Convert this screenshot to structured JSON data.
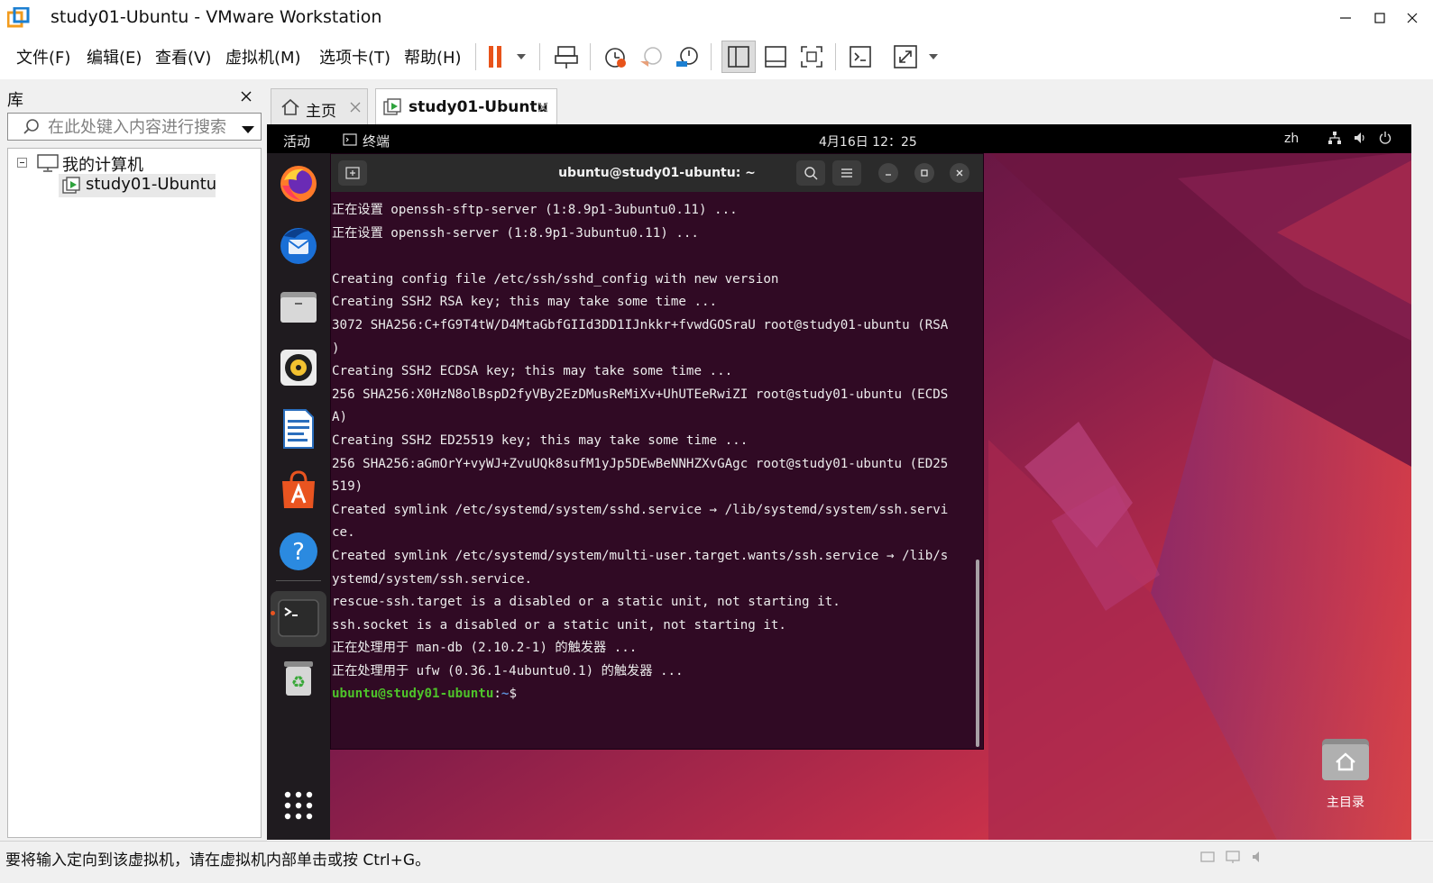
{
  "window": {
    "title": "study01-Ubuntu - VMware Workstation"
  },
  "menubar": {
    "items": [
      "文件(F)",
      "编辑(E)",
      "查看(V)",
      "虚拟机(M)",
      "选项卡(T)",
      "帮助(H)"
    ]
  },
  "library": {
    "title": "库",
    "search_placeholder": "在此处键入内容进行搜索",
    "tree_root": "我的计算机",
    "tree_vm": "study01-Ubuntu"
  },
  "tabs": [
    {
      "label": "主页"
    },
    {
      "label": "study01-Ubuntu"
    }
  ],
  "guest": {
    "activities": "活动",
    "app_menu": "终端",
    "clock": "4月16日  12：25",
    "language": "zh",
    "desktop_home_label": "主目录",
    "dock_icons": [
      "firefox",
      "thunderbird",
      "files",
      "rhythmbox",
      "libreoffice-writer",
      "app-center",
      "help",
      "terminal",
      "trash",
      "show-apps"
    ]
  },
  "terminal": {
    "title": "ubuntu@study01-ubuntu: ~",
    "lines": [
      "正在设置 openssh-sftp-server (1:8.9p1-3ubuntu0.11) ...",
      "正在设置 openssh-server (1:8.9p1-3ubuntu0.11) ...",
      "",
      "Creating config file /etc/ssh/sshd_config with new version",
      "Creating SSH2 RSA key; this may take some time ...",
      "3072 SHA256:C+fG9T4tW/D4MtaGbfGIId3DD1IJnkkr+fvwdGOSraU root@study01-ubuntu (RSA",
      ")",
      "Creating SSH2 ECDSA key; this may take some time ...",
      "256 SHA256:X0HzN8olBspD2fyVBy2EzDMusReMiXv+UhUTEeRwiZI root@study01-ubuntu (ECDS",
      "A)",
      "Creating SSH2 ED25519 key; this may take some time ...",
      "256 SHA256:aGmOrY+vyWJ+ZvuUQk8sufM1yJp5DEwBeNNHZXvGAgc root@study01-ubuntu (ED25",
      "519)",
      "Created symlink /etc/systemd/system/sshd.service → /lib/systemd/system/ssh.servi",
      "ce.",
      "Created symlink /etc/systemd/system/multi-user.target.wants/ssh.service → /lib/s",
      "ystemd/system/ssh.service.",
      "rescue-ssh.target is a disabled or a static unit, not starting it.",
      "ssh.socket is a disabled or a static unit, not starting it.",
      "正在处理用于 man-db (2.10.2-1) 的触发器 ...",
      "正在处理用于 ufw (0.36.1-4ubuntu0.1) 的触发器 ..."
    ],
    "prompt_user": "ubuntu@study01-ubuntu",
    "prompt_sep": ":",
    "prompt_path": "~",
    "prompt_symbol": "$"
  },
  "statusbar": {
    "text": "要将输入定向到该虚拟机，请在虚拟机内部单击或按 Ctrl+G。"
  },
  "colors": {
    "terminal_bg": "#300a24",
    "prompt_user": "#4ec32a",
    "prompt_path": "#5c8ed6",
    "pause_icon": "#e8531a",
    "ubuntu_orange": "#e95420"
  }
}
